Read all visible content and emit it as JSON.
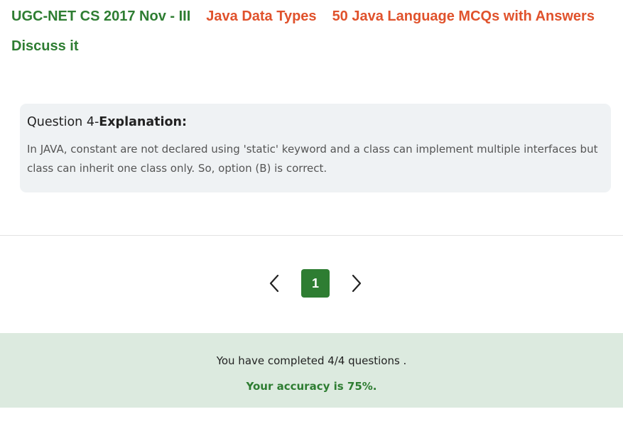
{
  "tags": {
    "exam": "UGC-NET CS 2017 Nov - III",
    "topic": "Java Data Types",
    "collection": "50 Java Language MCQs with Answers",
    "discuss": "Discuss it"
  },
  "explanation": {
    "question_label": "Question 4-",
    "heading": "Explanation:",
    "text": "In JAVA, constant are not declared using 'static' keyword and a class can implement multiple interfaces but class can inherit one class only. So, option (B) is correct."
  },
  "pagination": {
    "current_page": "1",
    "prev_icon": "chevron-left-icon",
    "next_icon": "chevron-right-icon"
  },
  "result": {
    "completed_text": "You have completed 4/4 questions .",
    "accuracy_text": "Your accuracy is 75%."
  },
  "colors": {
    "brand_green": "#2e7d32",
    "link_orange": "#e0522c",
    "panel_gray": "#eff2f4",
    "result_bg": "#dceadf"
  }
}
